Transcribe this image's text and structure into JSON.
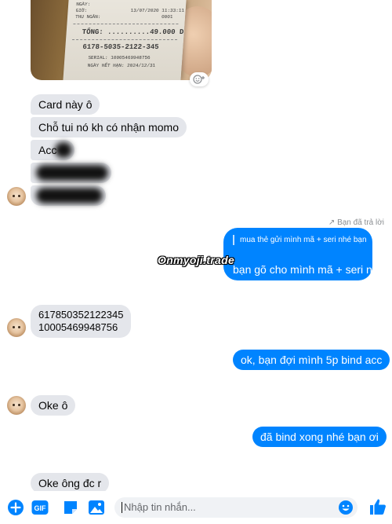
{
  "photo_message": {
    "receipt_lines": [
      "NGÀY:",
      "GIỜ:",
      "THU NGÂN:",
      "13/07/2020 11:33:11",
      "0001"
    ],
    "receipt_total": "TỔNG: ..........49.000 D",
    "receipt_serial": "6178-5035-2122-345",
    "receipt_seri": "SERIAL: 10005469948756",
    "receipt_expiry": "NGÀY HẾT HẠN: 2024/12/31",
    "react_icon": "add-reaction-icon"
  },
  "messages": {
    "m1": "Card này ô",
    "m2": "Chỗ tui nó kh có nhận momo",
    "m3": "Acc",
    "replied_label": "↗ Bạn đã trả lời",
    "reply_quote": "mua thẻ gửi mình mã + seri nhé bạn",
    "reply_text": "bạn gõ cho mình mã + seri nhé",
    "m4_line1": "617850352122345",
    "m4_line2": "10005469948756",
    "m5": "ok, bạn đợi mình 5p bind acc",
    "m6": "Oke ô",
    "m7": "đã bind xong nhé bạn ơi",
    "m8": "Oke ông đc r"
  },
  "watermark": "Onmyoji.trade",
  "composer": {
    "placeholder": "Nhập tin nhắn...",
    "gif_label": "GIF",
    "accent": "#0084ff"
  },
  "colors": {
    "incoming_bubble": "#e4e6eb",
    "outgoing_bubble": "#0084ff"
  }
}
